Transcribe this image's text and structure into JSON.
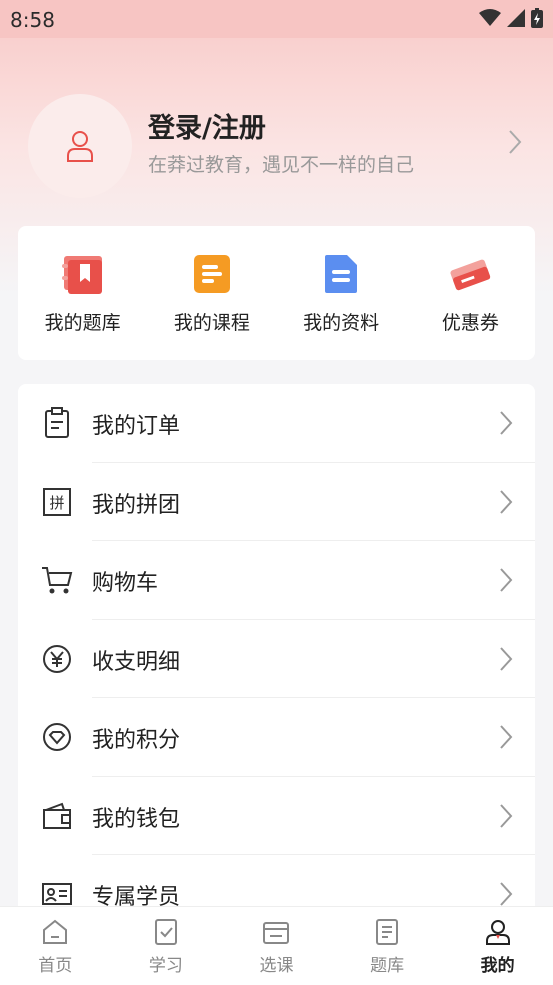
{
  "status": {
    "time": "8:58"
  },
  "profile": {
    "title": "登录/注册",
    "subtitle": "在莽过教育，遇见不一样的自己"
  },
  "quick": [
    {
      "label": "我的题库",
      "icon": "bookmark-book-icon"
    },
    {
      "label": "我的课程",
      "icon": "course-doc-icon"
    },
    {
      "label": "我的资料",
      "icon": "file-doc-icon"
    },
    {
      "label": "优惠券",
      "icon": "coupon-ticket-icon"
    }
  ],
  "menu": [
    {
      "label": "我的订单",
      "icon": "clipboard-icon"
    },
    {
      "label": "我的拼团",
      "icon": "group-buy-icon"
    },
    {
      "label": "购物车",
      "icon": "cart-icon"
    },
    {
      "label": "收支明细",
      "icon": "yen-icon"
    },
    {
      "label": "我的积分",
      "icon": "points-icon"
    },
    {
      "label": "我的钱包",
      "icon": "wallet-icon"
    },
    {
      "label": "专属学员",
      "icon": "id-card-icon"
    }
  ],
  "tabs": [
    {
      "label": "首页",
      "icon": "home-icon"
    },
    {
      "label": "学习",
      "icon": "study-icon"
    },
    {
      "label": "选课",
      "icon": "course-select-icon"
    },
    {
      "label": "题库",
      "icon": "question-bank-icon"
    },
    {
      "label": "我的",
      "icon": "user-icon",
      "active": true
    }
  ],
  "colors": {
    "accent": "#e8504a",
    "orange": "#f59b23",
    "blue": "#5b8ef0"
  }
}
